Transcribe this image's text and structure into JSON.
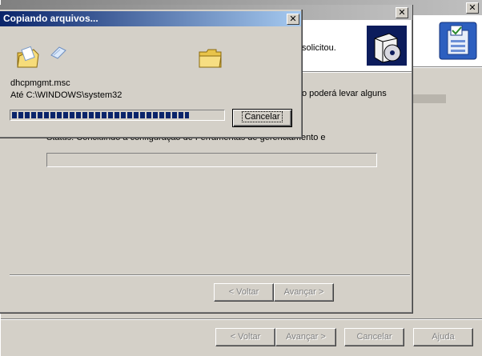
{
  "copy_dialog": {
    "title": "Copiando arquivos...",
    "file_name": "dhcpmgmt.msc",
    "destination": "Até C:\\WINDOWS\\system32",
    "progress": 0.84,
    "cancel_label": "Cancelar"
  },
  "wizard": {
    "header_text": "solicitou.",
    "info_text": "o poderá levar alguns",
    "status_text": "Status:   Concluindo a configuração de Ferramentas de gerenciamento e",
    "back_label": "< Voltar",
    "next_label": "Avançar >"
  },
  "outer_wizard": {
    "back_label": "< Voltar",
    "next_label": "Avançar >",
    "cancel_label": "Cancelar",
    "help_label": "Ajuda"
  },
  "icons": [
    "close-icon",
    "installer-box-icon",
    "wizard-app-icon",
    "open-folder-icon",
    "flying-paper-icon",
    "closed-folder-icon"
  ],
  "colors": {
    "titlebar_start": "#0a246a",
    "titlebar_end": "#a6caf0",
    "progress": "#0a246a",
    "desktop": "#3a6ea5",
    "face": "#d4d0c8"
  }
}
